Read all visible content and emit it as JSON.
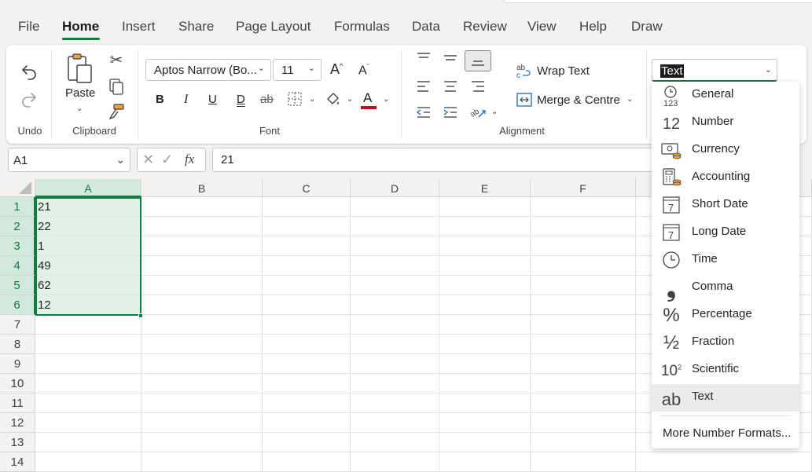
{
  "tabs": [
    "File",
    "Home",
    "Insert",
    "Share",
    "Page Layout",
    "Formulas",
    "Data",
    "Review",
    "View",
    "Help",
    "Draw"
  ],
  "active_tab": "Home",
  "ribbon": {
    "undo_label": "Undo",
    "paste_label": "Paste",
    "clipboard_label": "Clipboard",
    "font_name": "Aptos Narrow (Bo...",
    "font_size": "11",
    "grow_font": "A",
    "shrink_font": "A",
    "bold": "B",
    "italic": "I",
    "underline": "U",
    "double_underline": "D",
    "strike": "ab",
    "font_color_glyph": "A",
    "font_color": "#c50f1f",
    "font_label": "Font",
    "wrap_text_label": "Wrap Text",
    "merge_label": "Merge & Centre",
    "alignment_label": "Alignment",
    "number_format_value": "Text"
  },
  "formula_bar": {
    "name_box": "A1",
    "fx": "fx",
    "formula": "21"
  },
  "grid": {
    "columns": [
      "A",
      "B",
      "C",
      "D",
      "E",
      "F"
    ],
    "rows": [
      "1",
      "2",
      "3",
      "4",
      "5",
      "6",
      "7",
      "8",
      "9",
      "10",
      "11",
      "12",
      "13",
      "14"
    ],
    "a_values": [
      "21",
      "22",
      "1",
      "49",
      "62",
      "12"
    ]
  },
  "number_formats": [
    {
      "label": "General",
      "icon": "general-icon",
      "glyph": "123"
    },
    {
      "label": "Number",
      "icon": "number-icon",
      "glyph": "12"
    },
    {
      "label": "Currency",
      "icon": "currency-icon",
      "glyph": ""
    },
    {
      "label": "Accounting",
      "icon": "accounting-icon",
      "glyph": ""
    },
    {
      "label": "Short Date",
      "icon": "short-date-icon",
      "glyph": "7"
    },
    {
      "label": "Long Date",
      "icon": "long-date-icon",
      "glyph": "7"
    },
    {
      "label": "Time",
      "icon": "time-icon",
      "glyph": ""
    },
    {
      "label": "Comma",
      "icon": "comma-icon",
      "glyph": "❟"
    },
    {
      "label": "Percentage",
      "icon": "percentage-icon",
      "glyph": "%"
    },
    {
      "label": "Fraction",
      "icon": "fraction-icon",
      "glyph": "½"
    },
    {
      "label": "Scientific",
      "icon": "scientific-icon",
      "glyph": "10²"
    },
    {
      "label": "Text",
      "icon": "text-format-icon",
      "glyph": "ab"
    }
  ],
  "more_formats_label": "More Number Formats...",
  "colors": {
    "accent": "#107c41",
    "selection_fill": "#e3f0e7",
    "header_selected": "#d2e8da"
  }
}
